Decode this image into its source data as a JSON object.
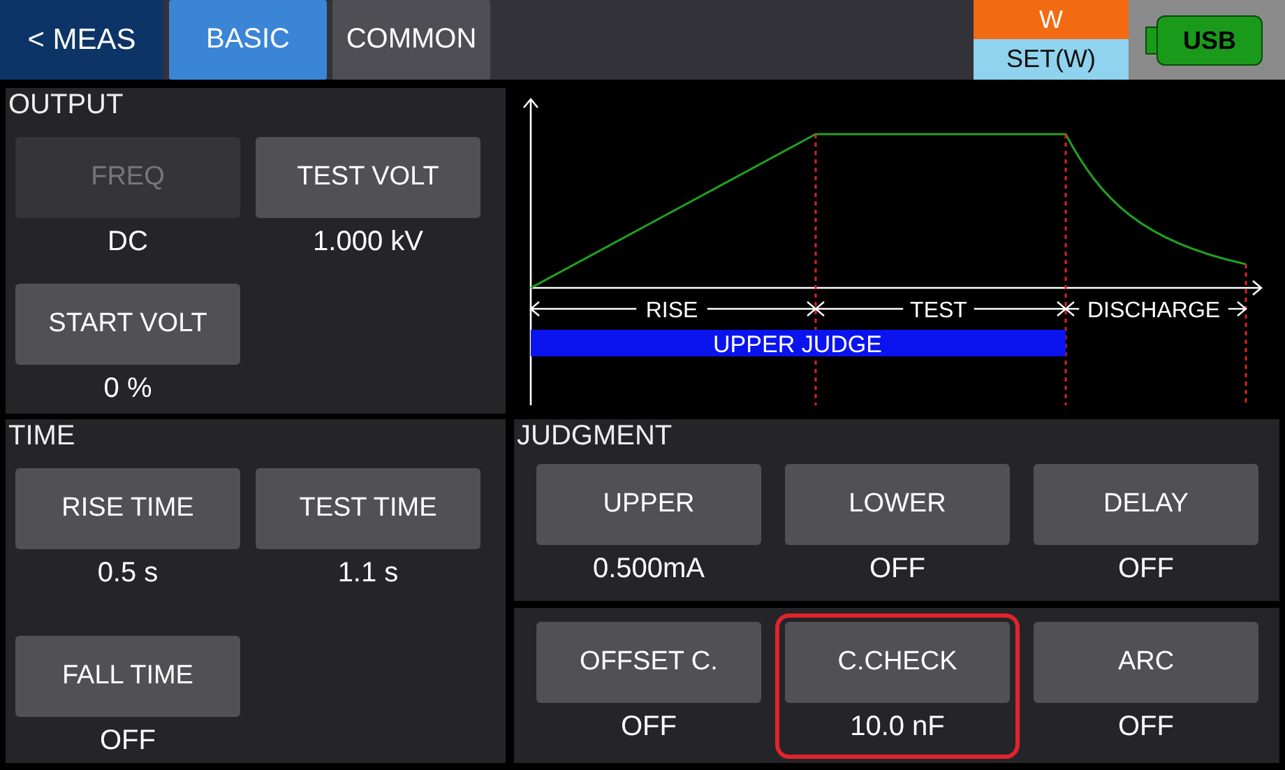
{
  "top_bar": {
    "back": "< MEAS",
    "tabs": [
      {
        "label": "BASIC",
        "selected": true
      },
      {
        "label": "COMMON",
        "selected": false
      }
    ],
    "mode": {
      "value": "W",
      "label": "SET(W)"
    },
    "usb": "USB"
  },
  "output": {
    "title": "OUTPUT",
    "settings": [
      {
        "label": "FREQ",
        "value": "DC",
        "disabled": true
      },
      {
        "label": "TEST VOLT",
        "value": "1.000 kV",
        "disabled": false
      },
      {
        "label": "START VOLT",
        "value": "0 %",
        "disabled": false
      }
    ]
  },
  "diagram": {
    "phases": [
      "RISE",
      "TEST",
      "DISCHARGE"
    ],
    "judge_bar": "UPPER JUDGE"
  },
  "time": {
    "title": "TIME",
    "settings": [
      {
        "label": "RISE TIME",
        "value": "0.5 s"
      },
      {
        "label": "TEST TIME",
        "value": "1.1 s"
      },
      {
        "label": "FALL TIME",
        "value": "OFF"
      }
    ]
  },
  "judgment": {
    "title": "JUDGMENT",
    "settings": [
      {
        "label": "UPPER",
        "value": "0.500mA"
      },
      {
        "label": "LOWER",
        "value": "OFF"
      },
      {
        "label": "DELAY",
        "value": "OFF"
      }
    ]
  },
  "checks": {
    "settings": [
      {
        "label": "OFFSET C.",
        "value": "OFF",
        "highlighted": false
      },
      {
        "label": "C.CHECK",
        "value": "10.0 nF",
        "highlighted": true
      },
      {
        "label": "ARC",
        "value": "OFF",
        "highlighted": false
      }
    ]
  }
}
